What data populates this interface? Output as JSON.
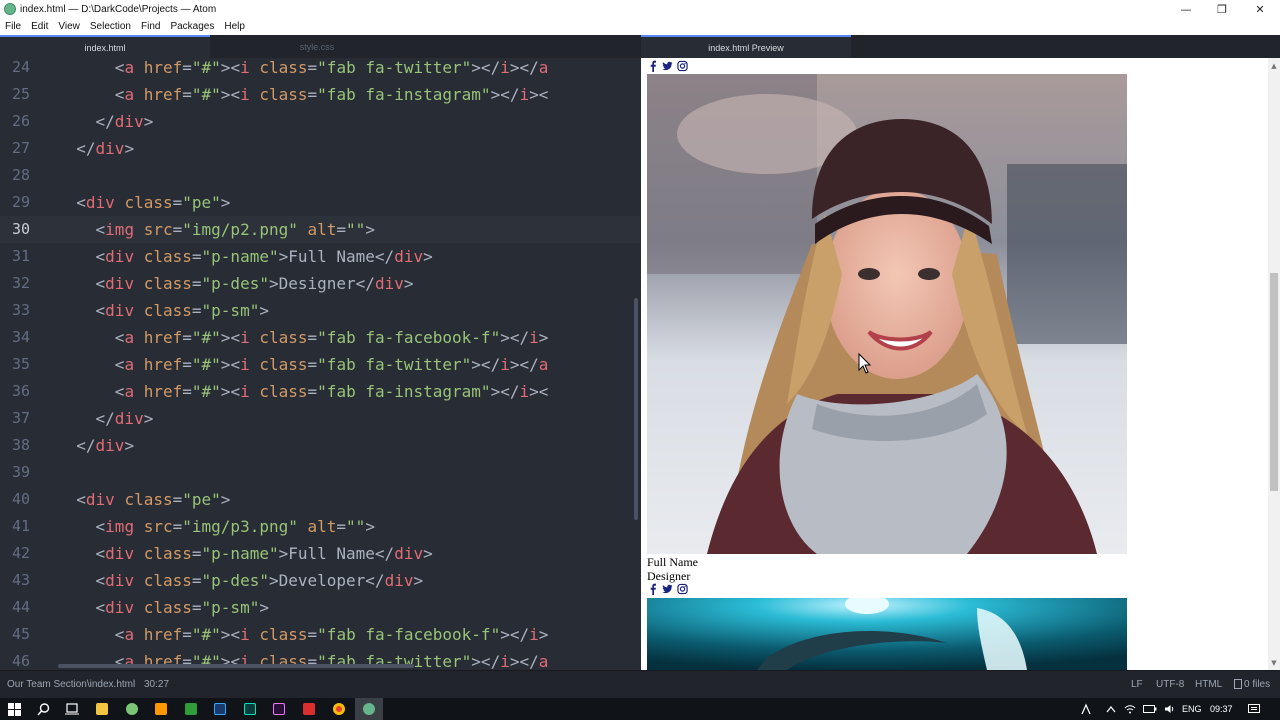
{
  "window": {
    "title": "index.html — D:\\DarkCode\\Projects — Atom",
    "minimize": "—",
    "restore": "❐",
    "close": "✕"
  },
  "menu": [
    "File",
    "Edit",
    "View",
    "Selection",
    "Find",
    "Packages",
    "Help"
  ],
  "tabs": [
    {
      "label": "index.html",
      "active": true
    },
    {
      "label": "style.css",
      "active": false
    },
    {
      "label": "index.html Preview",
      "active": true
    }
  ],
  "editor": {
    "lines": [
      {
        "n": "24",
        "indent": "      ",
        "parts": [
          [
            "p",
            "<"
          ],
          [
            "t",
            "a"
          ],
          [
            "p",
            " "
          ],
          [
            "a",
            "href"
          ],
          [
            "p",
            "="
          ],
          [
            "s",
            "\"#\""
          ],
          [
            "p",
            ">"
          ],
          [
            "p",
            "<"
          ],
          [
            "t",
            "i"
          ],
          [
            "p",
            " "
          ],
          [
            "a",
            "class"
          ],
          [
            "p",
            "="
          ],
          [
            "s",
            "\"fab fa-twitter\""
          ],
          [
            "p",
            "></"
          ],
          [
            "t",
            "i"
          ],
          [
            "p",
            "></"
          ],
          [
            "t",
            "a"
          ]
        ]
      },
      {
        "n": "25",
        "indent": "      ",
        "parts": [
          [
            "p",
            "<"
          ],
          [
            "t",
            "a"
          ],
          [
            "p",
            " "
          ],
          [
            "a",
            "href"
          ],
          [
            "p",
            "="
          ],
          [
            "s",
            "\"#\""
          ],
          [
            "p",
            ">"
          ],
          [
            "p",
            "<"
          ],
          [
            "t",
            "i"
          ],
          [
            "p",
            " "
          ],
          [
            "a",
            "class"
          ],
          [
            "p",
            "="
          ],
          [
            "s",
            "\"fab fa-instagram\""
          ],
          [
            "p",
            "></"
          ],
          [
            "t",
            "i"
          ],
          [
            "p",
            "><"
          ]
        ]
      },
      {
        "n": "26",
        "indent": "    ",
        "parts": [
          [
            "p",
            "</"
          ],
          [
            "t",
            "div"
          ],
          [
            "p",
            ">"
          ]
        ]
      },
      {
        "n": "27",
        "indent": "  ",
        "parts": [
          [
            "p",
            "</"
          ],
          [
            "t",
            "div"
          ],
          [
            "p",
            ">"
          ]
        ]
      },
      {
        "n": "28",
        "indent": "",
        "parts": []
      },
      {
        "n": "29",
        "indent": "  ",
        "parts": [
          [
            "p",
            "<"
          ],
          [
            "t",
            "div"
          ],
          [
            "p",
            " "
          ],
          [
            "a",
            "class"
          ],
          [
            "p",
            "="
          ],
          [
            "s",
            "\"pe\""
          ],
          [
            "p",
            ">"
          ]
        ]
      },
      {
        "n": "30",
        "indent": "    ",
        "parts": [
          [
            "p",
            "<"
          ],
          [
            "t",
            "img"
          ],
          [
            "p",
            " "
          ],
          [
            "a",
            "src"
          ],
          [
            "p",
            "="
          ],
          [
            "s",
            "\"img/p2.png\""
          ],
          [
            "p",
            " "
          ],
          [
            "a",
            "alt"
          ],
          [
            "p",
            "="
          ],
          [
            "s",
            "\"\""
          ],
          [
            "p",
            ">"
          ]
        ],
        "cursor": true
      },
      {
        "n": "31",
        "indent": "    ",
        "parts": [
          [
            "p",
            "<"
          ],
          [
            "t",
            "div"
          ],
          [
            "p",
            " "
          ],
          [
            "a",
            "class"
          ],
          [
            "p",
            "="
          ],
          [
            "s",
            "\"p-name\""
          ],
          [
            "p",
            ">Full Name</"
          ],
          [
            "t",
            "div"
          ],
          [
            "p",
            ">"
          ]
        ]
      },
      {
        "n": "32",
        "indent": "    ",
        "parts": [
          [
            "p",
            "<"
          ],
          [
            "t",
            "div"
          ],
          [
            "p",
            " "
          ],
          [
            "a",
            "class"
          ],
          [
            "p",
            "="
          ],
          [
            "s",
            "\"p-des\""
          ],
          [
            "p",
            ">Designer</"
          ],
          [
            "t",
            "div"
          ],
          [
            "p",
            ">"
          ]
        ]
      },
      {
        "n": "33",
        "indent": "    ",
        "parts": [
          [
            "p",
            "<"
          ],
          [
            "t",
            "div"
          ],
          [
            "p",
            " "
          ],
          [
            "a",
            "class"
          ],
          [
            "p",
            "="
          ],
          [
            "s",
            "\"p-sm\""
          ],
          [
            "p",
            ">"
          ]
        ]
      },
      {
        "n": "34",
        "indent": "      ",
        "parts": [
          [
            "p",
            "<"
          ],
          [
            "t",
            "a"
          ],
          [
            "p",
            " "
          ],
          [
            "a",
            "href"
          ],
          [
            "p",
            "="
          ],
          [
            "s",
            "\"#\""
          ],
          [
            "p",
            ">"
          ],
          [
            "p",
            "<"
          ],
          [
            "t",
            "i"
          ],
          [
            "p",
            " "
          ],
          [
            "a",
            "class"
          ],
          [
            "p",
            "="
          ],
          [
            "s",
            "\"fab fa-facebook-f\""
          ],
          [
            "p",
            "></"
          ],
          [
            "t",
            "i"
          ],
          [
            "p",
            ">"
          ]
        ]
      },
      {
        "n": "35",
        "indent": "      ",
        "parts": [
          [
            "p",
            "<"
          ],
          [
            "t",
            "a"
          ],
          [
            "p",
            " "
          ],
          [
            "a",
            "href"
          ],
          [
            "p",
            "="
          ],
          [
            "s",
            "\"#\""
          ],
          [
            "p",
            ">"
          ],
          [
            "p",
            "<"
          ],
          [
            "t",
            "i"
          ],
          [
            "p",
            " "
          ],
          [
            "a",
            "class"
          ],
          [
            "p",
            "="
          ],
          [
            "s",
            "\"fab fa-twitter\""
          ],
          [
            "p",
            "></"
          ],
          [
            "t",
            "i"
          ],
          [
            "p",
            "></"
          ],
          [
            "t",
            "a"
          ]
        ]
      },
      {
        "n": "36",
        "indent": "      ",
        "parts": [
          [
            "p",
            "<"
          ],
          [
            "t",
            "a"
          ],
          [
            "p",
            " "
          ],
          [
            "a",
            "href"
          ],
          [
            "p",
            "="
          ],
          [
            "s",
            "\"#\""
          ],
          [
            "p",
            ">"
          ],
          [
            "p",
            "<"
          ],
          [
            "t",
            "i"
          ],
          [
            "p",
            " "
          ],
          [
            "a",
            "class"
          ],
          [
            "p",
            "="
          ],
          [
            "s",
            "\"fab fa-instagram\""
          ],
          [
            "p",
            "></"
          ],
          [
            "t",
            "i"
          ],
          [
            "p",
            "><"
          ]
        ]
      },
      {
        "n": "37",
        "indent": "    ",
        "parts": [
          [
            "p",
            "</"
          ],
          [
            "t",
            "div"
          ],
          [
            "p",
            ">"
          ]
        ]
      },
      {
        "n": "38",
        "indent": "  ",
        "parts": [
          [
            "p",
            "</"
          ],
          [
            "t",
            "div"
          ],
          [
            "p",
            ">"
          ]
        ]
      },
      {
        "n": "39",
        "indent": "",
        "parts": []
      },
      {
        "n": "40",
        "indent": "  ",
        "parts": [
          [
            "p",
            "<"
          ],
          [
            "t",
            "div"
          ],
          [
            "p",
            " "
          ],
          [
            "a",
            "class"
          ],
          [
            "p",
            "="
          ],
          [
            "s",
            "\"pe\""
          ],
          [
            "p",
            ">"
          ]
        ]
      },
      {
        "n": "41",
        "indent": "    ",
        "parts": [
          [
            "p",
            "<"
          ],
          [
            "t",
            "img"
          ],
          [
            "p",
            " "
          ],
          [
            "a",
            "src"
          ],
          [
            "p",
            "="
          ],
          [
            "s",
            "\"img/p3.png\""
          ],
          [
            "p",
            " "
          ],
          [
            "a",
            "alt"
          ],
          [
            "p",
            "="
          ],
          [
            "s",
            "\"\""
          ],
          [
            "p",
            ">"
          ]
        ]
      },
      {
        "n": "42",
        "indent": "    ",
        "parts": [
          [
            "p",
            "<"
          ],
          [
            "t",
            "div"
          ],
          [
            "p",
            " "
          ],
          [
            "a",
            "class"
          ],
          [
            "p",
            "="
          ],
          [
            "s",
            "\"p-name\""
          ],
          [
            "p",
            ">Full Name</"
          ],
          [
            "t",
            "div"
          ],
          [
            "p",
            ">"
          ]
        ]
      },
      {
        "n": "43",
        "indent": "    ",
        "parts": [
          [
            "p",
            "<"
          ],
          [
            "t",
            "div"
          ],
          [
            "p",
            " "
          ],
          [
            "a",
            "class"
          ],
          [
            "p",
            "="
          ],
          [
            "s",
            "\"p-des\""
          ],
          [
            "p",
            ">Developer</"
          ],
          [
            "t",
            "div"
          ],
          [
            "p",
            ">"
          ]
        ]
      },
      {
        "n": "44",
        "indent": "    ",
        "parts": [
          [
            "p",
            "<"
          ],
          [
            "t",
            "div"
          ],
          [
            "p",
            " "
          ],
          [
            "a",
            "class"
          ],
          [
            "p",
            "="
          ],
          [
            "s",
            "\"p-sm\""
          ],
          [
            "p",
            ">"
          ]
        ]
      },
      {
        "n": "45",
        "indent": "      ",
        "parts": [
          [
            "p",
            "<"
          ],
          [
            "t",
            "a"
          ],
          [
            "p",
            " "
          ],
          [
            "a",
            "href"
          ],
          [
            "p",
            "="
          ],
          [
            "s",
            "\"#\""
          ],
          [
            "p",
            ">"
          ],
          [
            "p",
            "<"
          ],
          [
            "t",
            "i"
          ],
          [
            "p",
            " "
          ],
          [
            "a",
            "class"
          ],
          [
            "p",
            "="
          ],
          [
            "s",
            "\"fab fa-facebook-f\""
          ],
          [
            "p",
            "></"
          ],
          [
            "t",
            "i"
          ],
          [
            "p",
            ">"
          ]
        ]
      },
      {
        "n": "46",
        "indent": "      ",
        "parts": [
          [
            "p",
            "<"
          ],
          [
            "t",
            "a"
          ],
          [
            "p",
            " "
          ],
          [
            "a",
            "href"
          ],
          [
            "p",
            "="
          ],
          [
            "s",
            "\"#\""
          ],
          [
            "p",
            ">"
          ],
          [
            "p",
            "<"
          ],
          [
            "t",
            "i"
          ],
          [
            "p",
            " "
          ],
          [
            "a",
            "class"
          ],
          [
            "p",
            "="
          ],
          [
            "s",
            "\"fab fa-twitter\""
          ],
          [
            "p",
            "></"
          ],
          [
            "t",
            "i"
          ],
          [
            "p",
            "></"
          ],
          [
            "t",
            "a"
          ]
        ]
      }
    ]
  },
  "preview": {
    "card1_name": "Full Name",
    "card1_role": "Designer",
    "social_icons": [
      "facebook-icon",
      "twitter-icon",
      "instagram-icon"
    ]
  },
  "statusbar": {
    "path": "Our Team Section\\index.html",
    "cursor": "30:27",
    "line_ending": "LF",
    "encoding": "UTF-8",
    "grammar": "HTML",
    "files": "0 files"
  },
  "taskbar": {
    "lang": "ENG",
    "time": "09:37"
  },
  "colors": {
    "editor_bg": "#282c34",
    "tag": "#e06c75",
    "attr": "#d19a66",
    "string": "#98c379",
    "accent": "#568af2"
  }
}
